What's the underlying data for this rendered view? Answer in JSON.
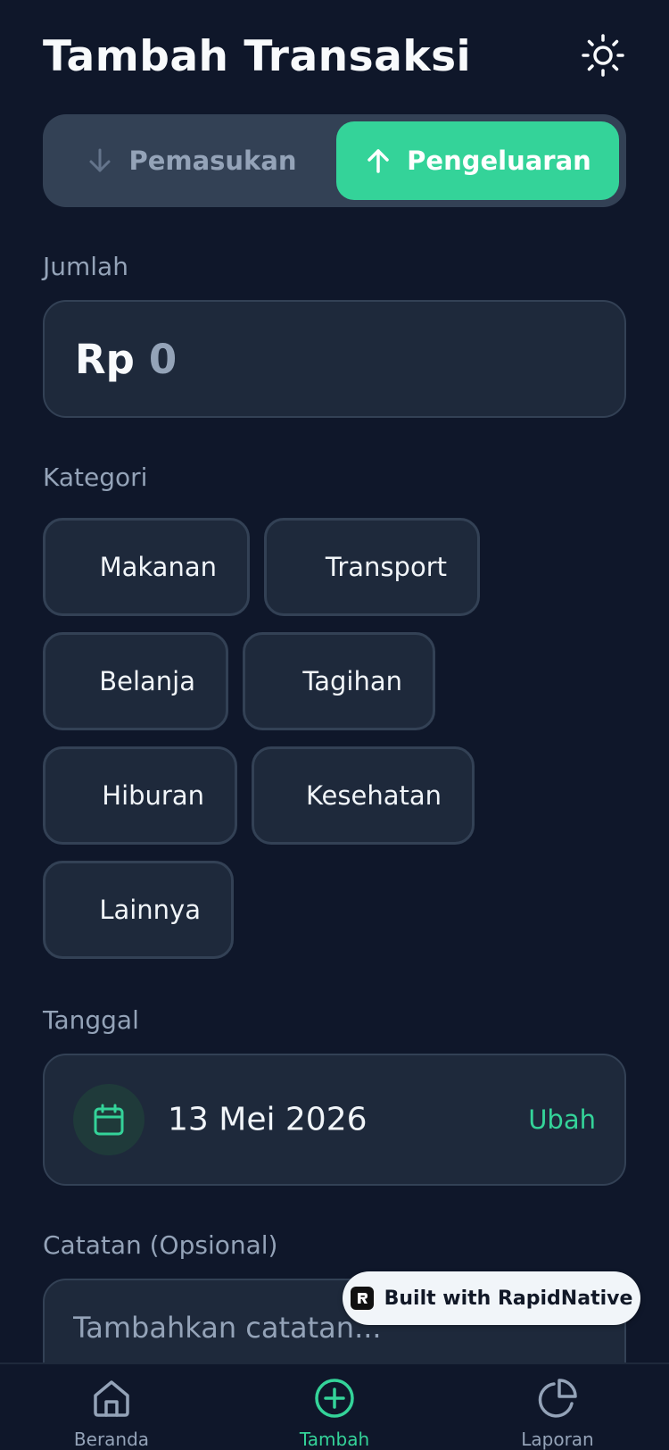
{
  "header": {
    "title": "Tambah Transaksi",
    "theme_icon": "sun-icon"
  },
  "type_toggle": {
    "income_label": "Pemasukan",
    "income_icon": "arrow-down-icon",
    "expense_label": "Pengeluaran",
    "expense_icon": "arrow-up-icon",
    "selected": "Pengeluaran"
  },
  "amount": {
    "label": "Jumlah",
    "currency": "Rp",
    "value": "0"
  },
  "category": {
    "label": "Kategori",
    "items": [
      {
        "label": "Makanan"
      },
      {
        "label": "Transport"
      },
      {
        "label": "Belanja"
      },
      {
        "label": "Tagihan"
      },
      {
        "label": "Hiburan"
      },
      {
        "label": "Kesehatan"
      },
      {
        "label": "Lainnya"
      }
    ]
  },
  "date": {
    "label": "Tanggal",
    "value": "13 Mei 2026",
    "change_label": "Ubah",
    "icon": "calendar-icon"
  },
  "note": {
    "label": "Catatan (Opsional)",
    "placeholder": "Tambahkan catatan...",
    "value": ""
  },
  "badge": {
    "text": "Built with RapidNative"
  },
  "nav": {
    "items": [
      {
        "label": "Beranda",
        "icon": "home-icon"
      },
      {
        "label": "Tambah",
        "icon": "plus-circle-icon",
        "active": true
      },
      {
        "label": "Laporan",
        "icon": "pie-chart-icon"
      }
    ]
  },
  "colors": {
    "background": "#0f172a",
    "card": "#1e293b",
    "border": "#334155",
    "accent": "#34d399",
    "muted": "#94a3b8"
  }
}
